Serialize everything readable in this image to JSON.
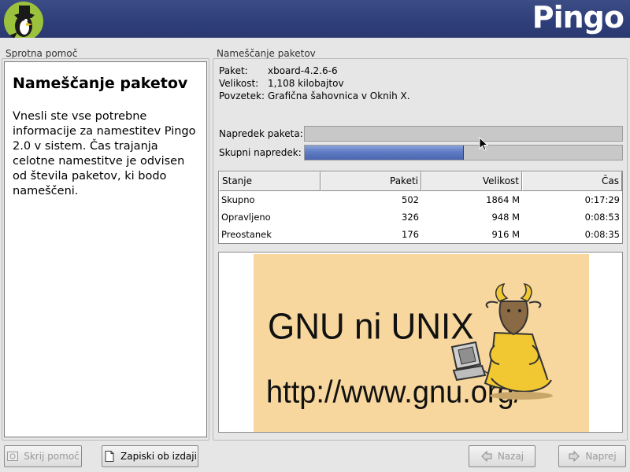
{
  "banner": {
    "brand": "Pingo"
  },
  "help": {
    "group_title": "Sprotna pomoč",
    "heading": "Nameščanje paketov",
    "body": "Vnesli ste vse potrebne informacije za namestitev Pingo 2.0 v sistem. Čas trajanja celotne namestitve je odvisen od števila paketov, ki bodo nameščeni."
  },
  "install": {
    "group_title": "Nameščanje paketov",
    "package_label": "Paket:",
    "package_value": "xboard-4.2.6-6",
    "size_label": "Velikost:",
    "size_value": "1,108 kilobajtov",
    "summary_label": "Povzetek:",
    "summary_value": "Grafična šahovnica v Oknih X.",
    "package_progress_label": "Napredek paketa:",
    "package_progress": 0.0,
    "total_progress_label": "Skupni napredek:",
    "total_progress": 0.5
  },
  "table": {
    "headers": [
      "Stanje",
      "Paketi",
      "Velikost",
      "Čas"
    ],
    "rows": [
      [
        "Skupno",
        "502",
        "1864 M",
        "0:17:29"
      ],
      [
        "Opravljeno",
        "326",
        "948 M",
        "0:08:53"
      ],
      [
        "Preostanek",
        "176",
        "916 M",
        "0:08:35"
      ]
    ]
  },
  "gnu_banner": {
    "title": "GNU ni UNIX",
    "url": "http://www.gnu.org/",
    "background_color": "#f7d79d"
  },
  "buttons": {
    "hide_help_label": "Skrij pomoč",
    "hide_help_mnemonic": "S",
    "release_notes_label": "Zapiski ob izdaji",
    "release_notes_mnemonic": "Z",
    "back_label": "Nazaj",
    "back_mnemonic": "z",
    "next_label": "Naprej",
    "next_mnemonic": "N"
  },
  "icons": {
    "logo": "penguin-logo-icon",
    "hide_help": "hide-help-icon",
    "release_notes": "document-icon",
    "back": "arrow-left-icon",
    "next": "arrow-right-icon"
  },
  "colors": {
    "banner": "#2e3e78",
    "progress_fill": "#5f7cc4"
  }
}
